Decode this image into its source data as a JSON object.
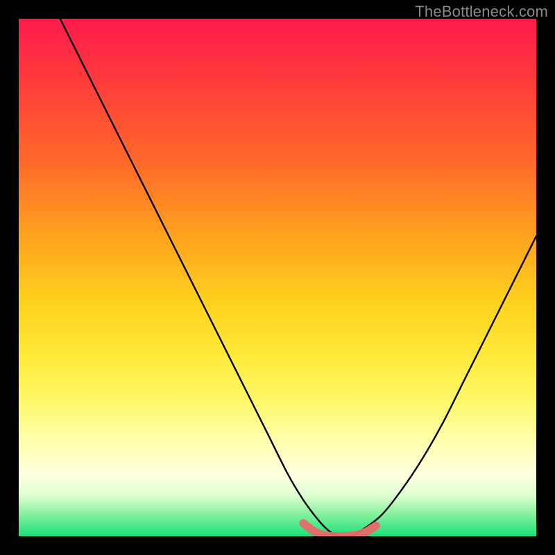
{
  "watermark": "TheBottleneck.com",
  "colors": {
    "frame": "#000000",
    "gradient_top": "#ff1a4d",
    "gradient_bottom": "#1ae07a",
    "curve_main": "#000000",
    "curve_highlight": "#e76a6a"
  },
  "chart_data": {
    "type": "line",
    "title": "",
    "xlabel": "",
    "ylabel": "",
    "xlim": [
      0,
      100
    ],
    "ylim": [
      0,
      100
    ],
    "grid": false,
    "legend": false,
    "series": [
      {
        "name": "bottleneck-curve",
        "x": [
          8,
          12,
          16,
          20,
          24,
          28,
          32,
          36,
          40,
          44,
          48,
          52,
          55,
          58,
          60,
          62,
          64,
          66,
          70,
          74,
          78,
          82,
          86,
          90,
          94,
          98,
          100
        ],
        "y": [
          100,
          92,
          84,
          76,
          68,
          60,
          52,
          44,
          36,
          28,
          20,
          12,
          7,
          3,
          1,
          0,
          0,
          1,
          4,
          9,
          15,
          22,
          30,
          38,
          46,
          54,
          58
        ]
      },
      {
        "name": "optimal-range",
        "x": [
          55,
          57,
          59,
          61,
          63,
          65,
          67,
          69
        ],
        "y": [
          2.5,
          1.0,
          0.2,
          0,
          0,
          0.2,
          0.8,
          2.0
        ]
      }
    ]
  }
}
